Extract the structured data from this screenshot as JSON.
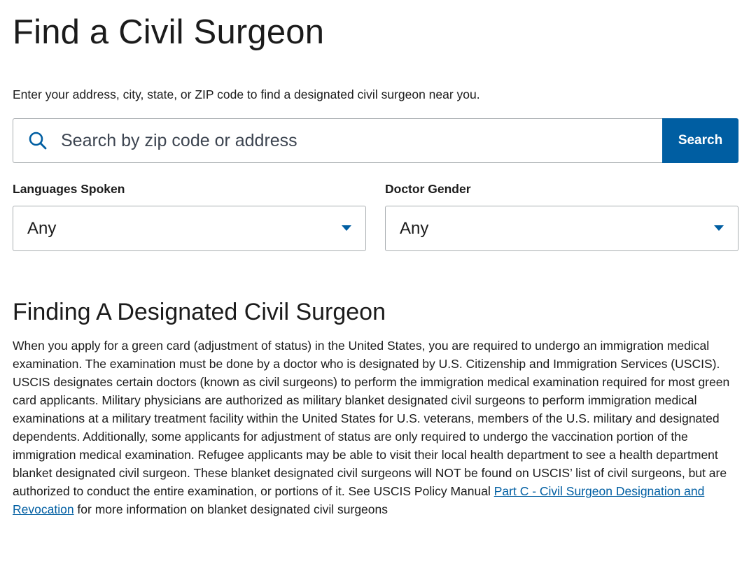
{
  "page": {
    "title": "Find a Civil Surgeon",
    "intro": "Enter your address, city, state, or ZIP code to find a designated civil surgeon near you."
  },
  "search": {
    "placeholder": "Search by zip code or address",
    "value": "",
    "button_label": "Search",
    "icon": "search-icon"
  },
  "filters": {
    "languages": {
      "label": "Languages Spoken",
      "selected": "Any"
    },
    "gender": {
      "label": "Doctor Gender",
      "selected": "Any"
    }
  },
  "info": {
    "heading": "Finding A Designated Civil Surgeon",
    "body_before_link": "When you apply for a green card (adjustment of status) in the United States, you are required to undergo an immigration medical examination. The examination must be done by a doctor who is designated by U.S. Citizenship and Immigration Services (USCIS). USCIS designates certain doctors (known as civil surgeons) to perform the immigration medical examination required for most green card applicants. Military physicians are authorized as military blanket designated civil surgeons to perform immigration medical examinations at a military treatment facility within the United States for U.S. veterans, members of the U.S. military and designated dependents.  Additionally, some applicants for adjustment of status are only required to undergo the vaccination portion of the immigration medical examination.   Refugee applicants may be able to visit their local health department to see a health department blanket designated civil surgeon.   These blanket designated civil surgeons will NOT be found on USCIS’ list of civil surgeons, but are authorized to conduct the entire examination, or portions of it.  See USCIS Policy Manual ",
    "link_text": "Part C - Civil Surgeon Designation and Revocation",
    "body_after_link": " for more information on blanket designated civil surgeons"
  },
  "colors": {
    "accent": "#005ea2",
    "text": "#1b1b1b",
    "border": "#a9aeb1"
  }
}
